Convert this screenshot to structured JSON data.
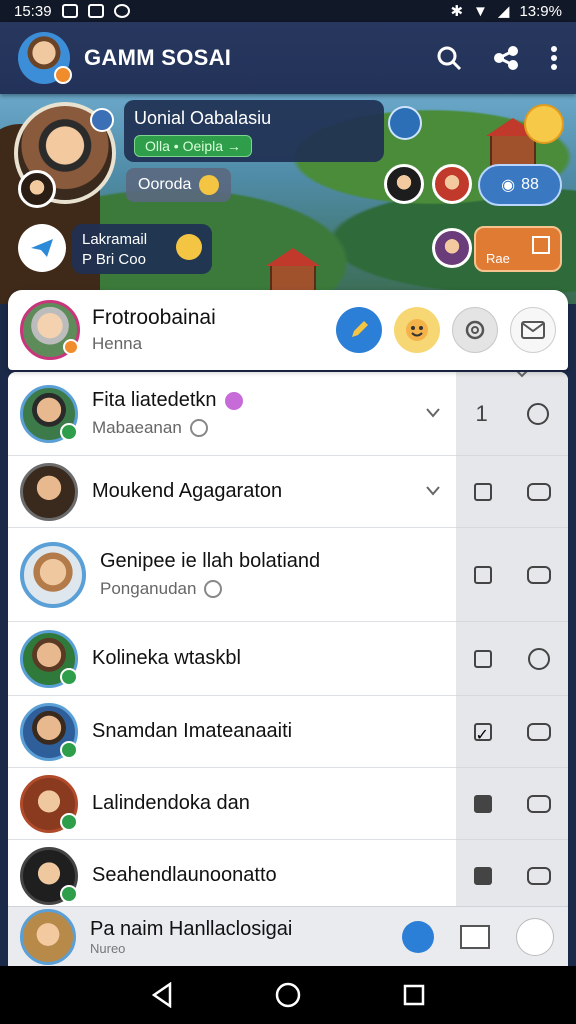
{
  "status_bar": {
    "time": "15:39",
    "battery": "13:9%"
  },
  "app_bar": {
    "title": "GAMM SOSAI"
  },
  "game": {
    "bubble_title": "Uonial Oabalasiu",
    "bubble_tag": "Olla • Oeipla →",
    "chip_label": "Ooroda",
    "secondary_line1": "Lakramail",
    "secondary_line2": "P Bri Coo",
    "pill_blue_label": "88",
    "pill_orange_label": "Rae"
  },
  "profile_card": {
    "name": "Frotroobainai",
    "subtitle": "Henna"
  },
  "friends": [
    {
      "name": "Fita liatedetkn",
      "sub": "Mabaeanan"
    },
    {
      "name": "Moukend Agagaraton",
      "sub": ""
    },
    {
      "name": "Genipee ie llah bolatiand",
      "sub": "Ponganudan"
    },
    {
      "name": "Kolineka wtaskbl",
      "sub": ""
    },
    {
      "name": "Snamdan Imateanaaiti",
      "sub": ""
    },
    {
      "name": "Lalindendoka dan",
      "sub": ""
    },
    {
      "name": "Seahendlaunoonatto",
      "sub": ""
    }
  ],
  "side_column": {
    "first_value": "1"
  },
  "bottom_bar": {
    "name": "Pa naim Hanllaclosigai",
    "sub": "Nureo"
  },
  "colors": {
    "accent": "#2c7fd6",
    "online": "#2f9e4a",
    "appbar": "#27375e"
  }
}
